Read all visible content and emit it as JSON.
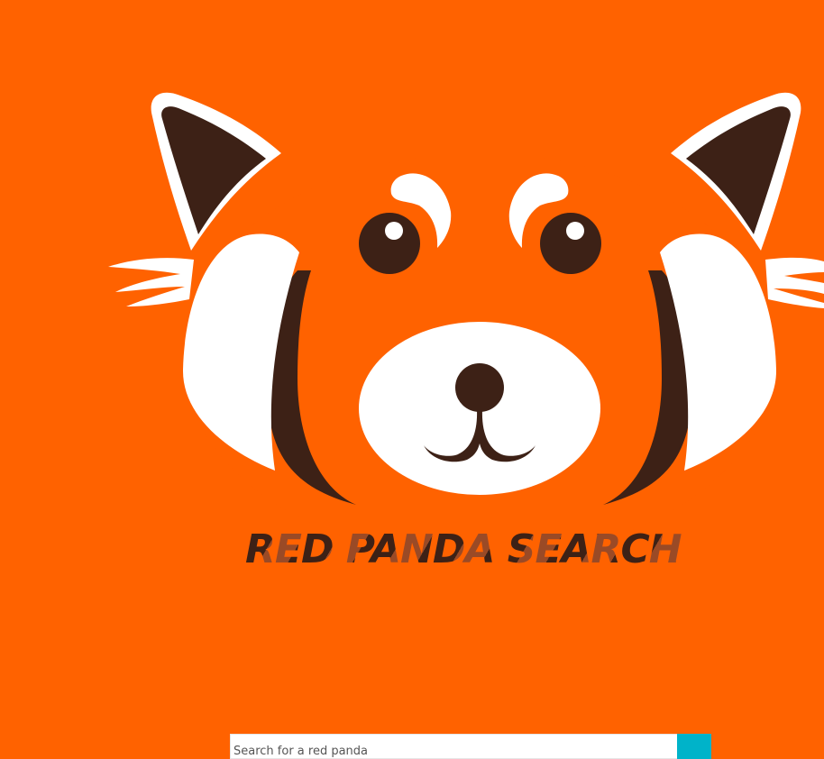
{
  "brand": {
    "title": "RED PANDA SEARCH",
    "colors": {
      "background": "#ff6200",
      "dark_brown": "#3d2116",
      "light_brown": "#9a4a26",
      "white": "#ffffff",
      "accent": "#00b3c9"
    }
  },
  "logo": {
    "alt": "red panda face",
    "icon": "red-panda-face-icon"
  },
  "search": {
    "placeholder": "Search for a red panda",
    "value": "",
    "button_icon": "search-icon"
  }
}
